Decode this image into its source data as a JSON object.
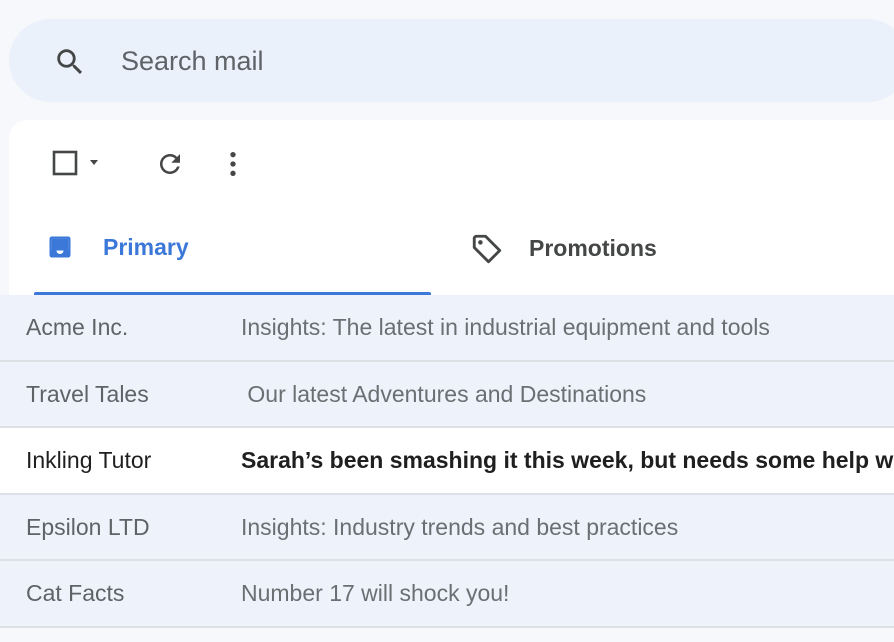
{
  "search": {
    "placeholder": "Search mail"
  },
  "tabs": [
    {
      "label": "Primary",
      "icon": "inbox-icon",
      "selected": true
    },
    {
      "label": "Promotions",
      "icon": "tag-icon",
      "selected": false
    }
  ],
  "emails": [
    {
      "sender": "Acme Inc.",
      "subject": "Insights: The latest in industrial equipment and tools",
      "unread": false
    },
    {
      "sender": "Travel Tales",
      "subject": " Our latest Adventures and Destinations",
      "unread": false
    },
    {
      "sender": "Inkling Tutor",
      "subject": "Sarah’s been smashing it this week, but needs some help with fractions",
      "unread": true
    },
    {
      "sender": "Epsilon LTD",
      "subject": "Insights: Industry trends and best practices",
      "unread": false
    },
    {
      "sender": "Cat Facts",
      "subject": "Number 17 will shock you!",
      "unread": false
    }
  ],
  "colors": {
    "accent": "#3b78d8",
    "search_bg": "#eaf1fb",
    "read_row_bg": "#eef2fa",
    "unread_row_bg": "#ffffff"
  }
}
